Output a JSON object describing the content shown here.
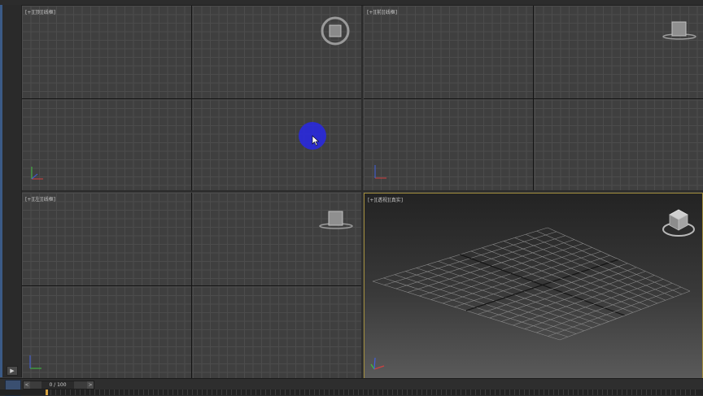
{
  "viewports": {
    "top": {
      "label": "[+][顶][线框]"
    },
    "front": {
      "label": "[+][前][线框]"
    },
    "left": {
      "label": "[+][左][线框]"
    },
    "perspective": {
      "label": "[+][透视][真实]"
    }
  },
  "time_slider": {
    "value": "0 / 100",
    "prev_label": "<",
    "next_label": ">"
  },
  "left_toolbar": {
    "expand_label": "▶"
  },
  "icons": {
    "viewcube_top": "viewcube-top-icon",
    "viewcube_front": "viewcube-front-icon",
    "viewcube_left": "viewcube-left-icon",
    "viewcube_perspective": "viewcube-perspective-icon",
    "axis_tripod": "axis-tripod-icon",
    "cursor": "mouse-cursor-icon"
  },
  "colors": {
    "active_viewport_border": "#a08c3c",
    "cursor_highlight": "#2828e6",
    "axis_x": "#d04040",
    "axis_y": "#40c040",
    "axis_z": "#4060e0"
  }
}
